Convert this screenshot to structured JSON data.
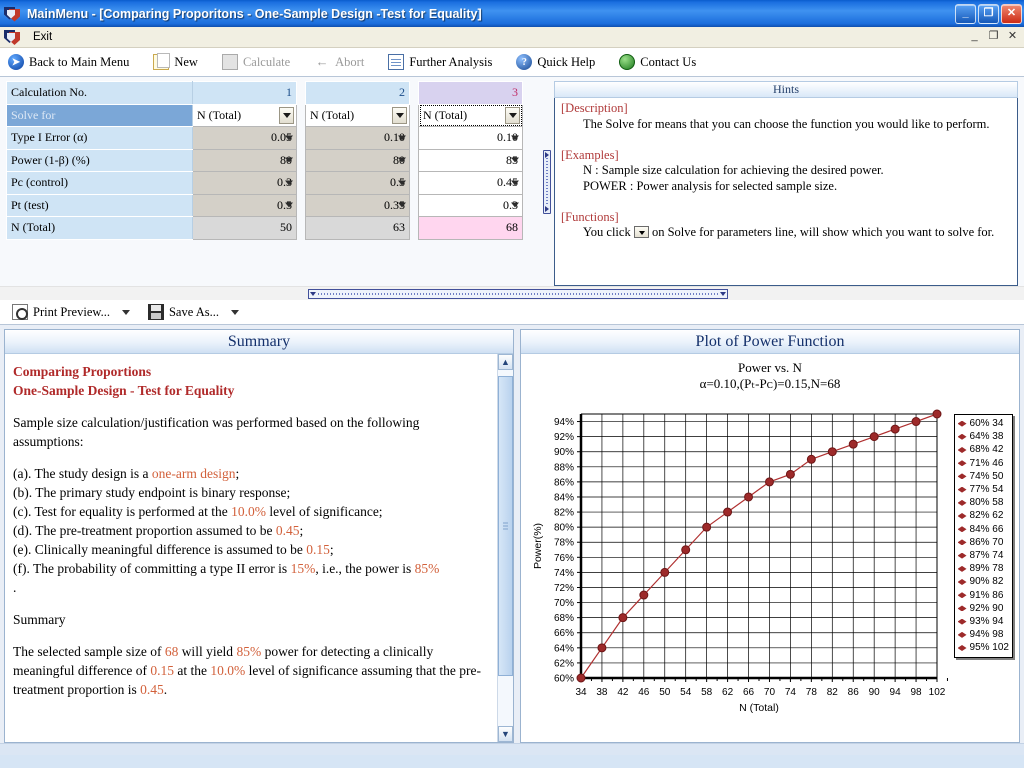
{
  "window": {
    "title": "MainMenu - [Comparing Proporitons - One-Sample Design -Test for Equality]",
    "app_icon": "shield-icon",
    "minimize": "_",
    "maximize": "❐",
    "close": "✕",
    "mdi_minimize": "_",
    "mdi_restore": "❐",
    "mdi_close": "✕"
  },
  "menu": {
    "items": [
      {
        "label": "Exit",
        "icon": "shield-icon"
      }
    ]
  },
  "toolbar": {
    "items": [
      {
        "label": "Back to Main Menu",
        "mnemonic": "M",
        "icon": "back-arrow-icon",
        "glyph": "➤",
        "disabled": false
      },
      {
        "label": "New",
        "mnemonic": "N",
        "icon": "new-document-icon",
        "glyph": "",
        "disabled": false
      },
      {
        "label": "Calculate",
        "mnemonic": "C",
        "icon": "calculate-icon",
        "glyph": "",
        "disabled": true
      },
      {
        "label": "Abort",
        "mnemonic": "A",
        "icon": "abort-arrow-icon",
        "glyph": "←",
        "disabled": true
      },
      {
        "label": "Further Analysis",
        "mnemonic": "F",
        "icon": "grid-table-icon",
        "glyph": "",
        "disabled": false
      },
      {
        "label": "Quick Help",
        "mnemonic": "Q",
        "icon": "question-circle-icon",
        "glyph": "?",
        "disabled": false
      },
      {
        "label": "Contact Us",
        "mnemonic": "",
        "icon": "globe-icon",
        "glyph": "",
        "disabled": false
      }
    ]
  },
  "sub_toolbar": {
    "items": [
      {
        "label": "Print Preview...",
        "mnemonic": "P",
        "icon": "print-preview-icon",
        "dropdown": true
      },
      {
        "label": "Save As...",
        "mnemonic": "S",
        "icon": "save-disk-icon",
        "dropdown": true
      }
    ]
  },
  "grid": {
    "row_labels": [
      "Calculation No.",
      "Solve for",
      "Type I Error (α)",
      "Power (1-β) (%)",
      "Pc (control)",
      "Pt (test)",
      "N (Total)"
    ],
    "selected_row_label": "Solve for",
    "active_column_index": 2,
    "columns": [
      {
        "calc_no": "1",
        "solve_for": "N (Total)",
        "alpha": "0.05",
        "power": "80",
        "pc": "0.3",
        "pt": "0.5",
        "n_total": "50"
      },
      {
        "calc_no": "2",
        "solve_for": "N (Total)",
        "alpha": "0.10",
        "power": "80",
        "pc": "0.5",
        "pt": "0.35",
        "n_total": "63"
      },
      {
        "calc_no": "3",
        "solve_for": "N (Total)",
        "alpha": "0.10",
        "power": "85",
        "pc": "0.45",
        "pt": "0.3",
        "n_total": "68"
      }
    ]
  },
  "hints": {
    "caption": "Hints",
    "sections": [
      {
        "heading": "[Description]",
        "lines": [
          "The Solve for means that you can choose the function you would like to perform."
        ]
      },
      {
        "heading": "[Examples]",
        "lines": [
          "N : Sample size calculation for achieving the desired power.",
          "POWER : Power analysis for selected sample size."
        ]
      },
      {
        "heading": "[Functions]",
        "lines": [
          "You click ▼ on Solve for parameters line, will show which you want to solve for."
        ]
      }
    ],
    "functions_pre": "You click",
    "functions_post": "on Solve for parameters line, will show which you want to solve for."
  },
  "summary": {
    "caption": "Summary",
    "title_line1": "Comparing Proportions",
    "title_line2": "One-Sample Design - Test for Equality",
    "intro": "Sample size calculation/justification was performed based on the following assumptions:",
    "assumptions": [
      {
        "prefix": "(a). The study design is a ",
        "hi": "one-arm design",
        "suffix": ";"
      },
      {
        "prefix": "(b). The primary study endpoint is binary response;",
        "hi": "",
        "suffix": ""
      },
      {
        "prefix": "(c). Test for equality is performed at the ",
        "hi": "10.0%",
        "suffix": " level of significance;"
      },
      {
        "prefix": "(d). The pre-treatment proportion assumed to be ",
        "hi": "0.45",
        "suffix": ";"
      },
      {
        "prefix": "(e). Clinically meaningful difference is assumed to be ",
        "hi": "0.15",
        "suffix": ";"
      },
      {
        "prefix": "(f). The probability of committing a type II error is ",
        "hi": "15%",
        "suffix": ", i.e., the power is ",
        "hi2": "85%"
      }
    ],
    "dot": ".",
    "section_heading": "Summary",
    "conclusion": {
      "p1": "The selected sample size of ",
      "n": "68",
      "p2": " will yield ",
      "power": "85%",
      "p3": " power for detecting a clinically meaningful difference of ",
      "diff": "0.15",
      "p4": " at the ",
      "alpha": "10.0%",
      "p5": " level of significance assuming that the pre-treatment proportion is ",
      "pc": "0.45",
      "p6": "."
    }
  },
  "plot": {
    "caption": "Plot of Power Function"
  },
  "chart_data": {
    "type": "line",
    "title": "Power vs. N",
    "subtitle": "α=0.10,(Pₜ-Pᴄ)=0.15,N=68",
    "xlabel": "N (Total)",
    "ylabel": "Power(%)",
    "xlim": [
      34,
      102
    ],
    "ylim": [
      60,
      95
    ],
    "xticks": [
      34,
      38,
      42,
      46,
      50,
      54,
      58,
      62,
      66,
      70,
      74,
      78,
      82,
      86,
      90,
      94,
      98,
      102
    ],
    "yticks": [
      "60%",
      "62%",
      "64%",
      "66%",
      "68%",
      "70%",
      "72%",
      "74%",
      "76%",
      "78%",
      "80%",
      "82%",
      "84%",
      "86%",
      "88%",
      "90%",
      "92%",
      "94%"
    ],
    "grid": true,
    "legend_position": "right",
    "marker_color": "#9d2a2a",
    "line_color": "#b03030",
    "x": [
      34,
      38,
      42,
      46,
      50,
      54,
      58,
      62,
      66,
      70,
      74,
      78,
      82,
      86,
      90,
      94,
      98,
      102
    ],
    "values": [
      60,
      64,
      68,
      71,
      74,
      77,
      80,
      82,
      84,
      86,
      87,
      89,
      90,
      91,
      92,
      93,
      94,
      95
    ],
    "legend": [
      "60% 34",
      "64% 38",
      "68% 42",
      "71% 46",
      "74% 50",
      "77% 54",
      "80% 58",
      "82% 62",
      "84% 66",
      "86% 70",
      "87% 74",
      "89% 78",
      "90% 82",
      "91% 86",
      "92% 90",
      "93% 94",
      "94% 98",
      "95% 102"
    ]
  }
}
